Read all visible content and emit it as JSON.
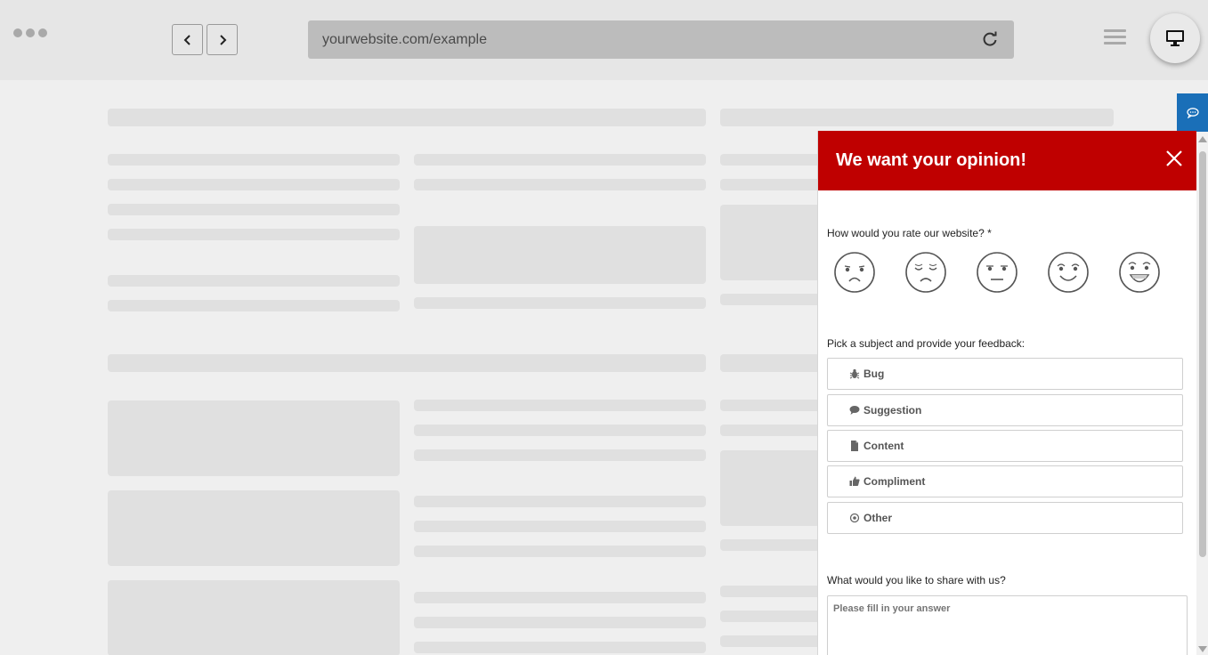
{
  "browser": {
    "url": "yourwebsite.com/example",
    "back_icon": "chevron-left-icon",
    "forward_icon": "chevron-right-icon",
    "reload_icon": "reload-icon",
    "menu_icon": "hamburger-menu-icon",
    "device_icon": "monitor-icon"
  },
  "feedback_tab": {
    "icon": "chat-bubble-icon",
    "color": "#1a6fb8"
  },
  "panel": {
    "title": "We want your opinion!",
    "header_color": "#bf0000",
    "close_icon": "close-icon",
    "rating": {
      "question": "How would you rate our website?",
      "required_mark": "*",
      "options": [
        "very-unhappy-face-icon",
        "unhappy-face-icon",
        "neutral-face-icon",
        "happy-face-icon",
        "very-happy-face-icon"
      ]
    },
    "subject": {
      "question": "Pick a subject and provide your feedback:",
      "options": [
        {
          "label": "Bug",
          "icon": "bug-icon"
        },
        {
          "label": "Suggestion",
          "icon": "speech-bubble-icon"
        },
        {
          "label": "Content",
          "icon": "document-icon"
        },
        {
          "label": "Compliment",
          "icon": "thumbs-up-icon"
        },
        {
          "label": "Other",
          "icon": "circle-dot-icon"
        }
      ]
    },
    "share": {
      "question": "What would you like to share with us?",
      "placeholder": "Please fill in your answer"
    }
  }
}
